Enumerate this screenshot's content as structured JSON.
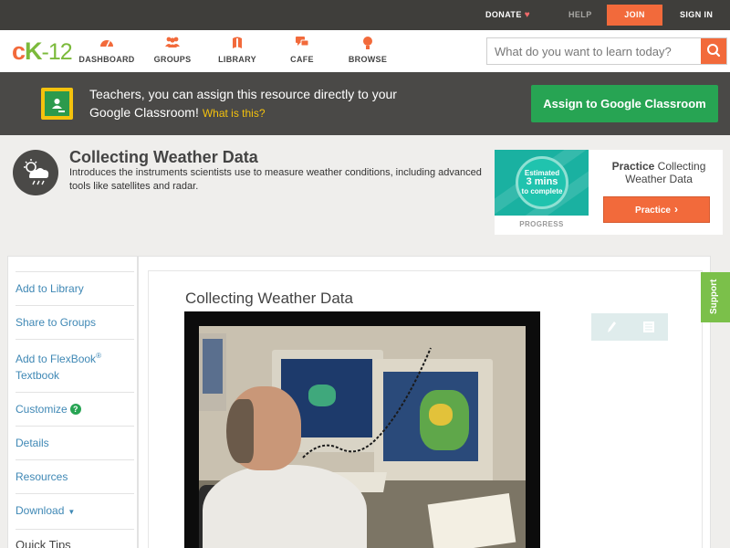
{
  "topbar": {
    "donate": "DONATE",
    "help": "HELP",
    "join": "JOIN",
    "signin": "SIGN IN"
  },
  "nav": {
    "logo": {
      "c": "c",
      "k": "K",
      "num": "-12"
    },
    "items": [
      {
        "label": "DASHBOARD",
        "icon": "dashboard-icon"
      },
      {
        "label": "GROUPS",
        "icon": "groups-icon"
      },
      {
        "label": "LIBRARY",
        "icon": "library-icon"
      },
      {
        "label": "CAFE",
        "icon": "cafe-icon"
      },
      {
        "label": "BROWSE",
        "icon": "browse-icon"
      }
    ],
    "search": {
      "placeholder": "What do you want to learn today?"
    }
  },
  "gbanner": {
    "text": "Teachers, you can assign this resource directly to your Google Classroom!",
    "what": "What is this?",
    "button": "Assign to Google Classroom"
  },
  "concept": {
    "title": "Collecting Weather Data",
    "description": "Introduces the instruments scientists use to measure weather conditions, including advanced tools like satellites and radar."
  },
  "practice": {
    "estimated": "Estimated",
    "mins": "3 mins",
    "complete": "to complete",
    "progress_label": "PROGRESS",
    "title_bold": "Practice",
    "title_rest": "Collecting Weather Data",
    "button": "Practice"
  },
  "sidebar": {
    "items": [
      {
        "label": "Add to Library"
      },
      {
        "label": "Share to Groups"
      },
      {
        "label": "Add to FlexBook",
        "sup": "®",
        "label2": "Textbook"
      },
      {
        "label": "Customize",
        "badge": "?"
      },
      {
        "label": "Details"
      },
      {
        "label": "Resources"
      },
      {
        "label": "Download",
        "caret": "▼"
      }
    ],
    "quick_tips": "Quick Tips"
  },
  "main": {
    "title": "Collecting Weather Data"
  },
  "support": "Support",
  "colors": {
    "accent": "#f26a3b",
    "brand_green": "#7bba3b",
    "classroom_green": "#27a453",
    "link": "#3f88b5"
  }
}
